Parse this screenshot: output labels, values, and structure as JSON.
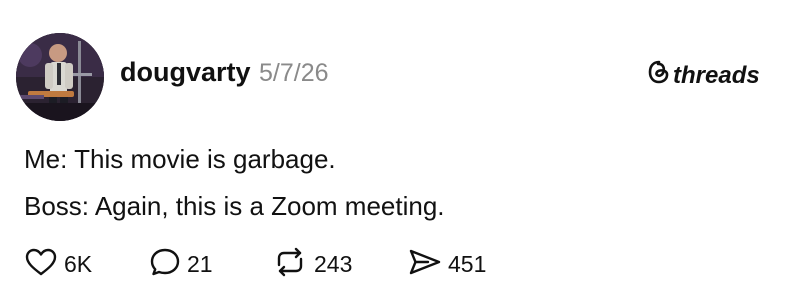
{
  "post": {
    "username": "dougvarty",
    "date": "5/7/26",
    "brand": "threads",
    "text_lines": [
      "Me: This movie is garbage.",
      "Boss: Again, this is a Zoom meeting."
    ]
  },
  "actions": {
    "likes": "6K",
    "replies": "21",
    "reposts": "243",
    "shares": "451"
  },
  "icons": {
    "brand": "threads-logo-icon",
    "like": "heart-icon",
    "reply": "speech-bubble-icon",
    "repost": "repost-arrows-icon",
    "share": "paper-plane-icon"
  },
  "colors": {
    "text": "#111111",
    "date": "#8a8a8a",
    "background": "#ffffff"
  }
}
